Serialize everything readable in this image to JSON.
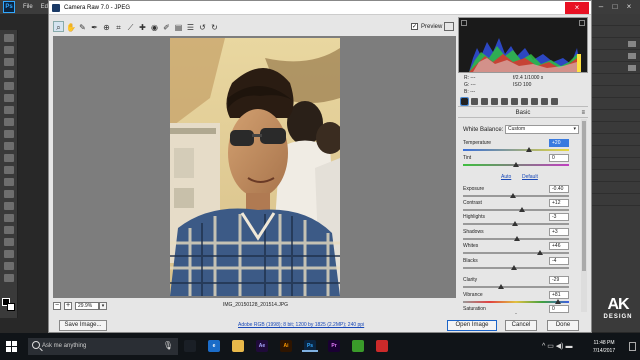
{
  "ps": {
    "logo": "Ps",
    "menu": [
      "File",
      "Edit"
    ],
    "window_controls": [
      "–",
      "□",
      "×"
    ]
  },
  "dialog": {
    "title": "Camera Raw 7.0  -  JPEG",
    "close_glyph": "×",
    "preview_label": "Preview",
    "preview_checked": "✓",
    "zoom_value": "29.9%",
    "filename": "IMG_20150128_201514.JPG",
    "buttons": {
      "save_image": "Save Image...",
      "open_image": "Open Image",
      "cancel": "Cancel",
      "done": "Done"
    },
    "workflow_link": "Adobe RGB (1998); 8 bit; 1200 by 1825 (2.2MP); 240 ppi"
  },
  "tools": [
    "zoom-icon",
    "hand-icon",
    "white-balance-icon",
    "color-sampler-icon",
    "targeted-adjustment-icon",
    "crop-icon",
    "straighten-icon",
    "spot-removal-icon",
    "red-eye-icon",
    "adjustment-brush-icon",
    "graduated-filter-icon",
    "preferences-icon",
    "rotate-ccw-icon",
    "rotate-cw-icon"
  ],
  "readout": {
    "r": "R:  ---",
    "g": "G:  ---",
    "b": "B:  ---",
    "exif1": "f/2.4   1/1000 s",
    "exif2": "ISO 100"
  },
  "panel": {
    "header": "Basic",
    "white_balance_label": "White Balance:",
    "white_balance_value": "Custom",
    "auto": "Auto",
    "default": "Default",
    "sliders": [
      {
        "label": "Temperature",
        "value": "+20",
        "pos": 0.62
      },
      {
        "label": "Tint",
        "value": "0",
        "pos": 0.5
      },
      {
        "label": "Exposure",
        "value": "-0.40",
        "pos": 0.47
      },
      {
        "label": "Contrast",
        "value": "+12",
        "pos": 0.56
      },
      {
        "label": "Highlights",
        "value": "-3",
        "pos": 0.49
      },
      {
        "label": "Shadows",
        "value": "+3",
        "pos": 0.51
      },
      {
        "label": "Whites",
        "value": "+46",
        "pos": 0.73
      },
      {
        "label": "Blacks",
        "value": "-4",
        "pos": 0.48
      },
      {
        "label": "Clarity",
        "value": "-29",
        "pos": 0.36
      },
      {
        "label": "Vibrance",
        "value": "+81",
        "pos": 0.9
      },
      {
        "label": "Saturation",
        "value": "0",
        "pos": 0.5
      }
    ]
  },
  "watermark": {
    "big": "AK",
    "small": "DESIGN"
  },
  "taskbar": {
    "search_placeholder": "Ask me anything",
    "apps": [
      {
        "name": "task-view-icon",
        "label": "",
        "bg": "#1a1f26",
        "fg": "#fff"
      },
      {
        "name": "edge-icon",
        "label": "e",
        "bg": "#1b6cc8",
        "fg": "#fff"
      },
      {
        "name": "file-explorer-icon",
        "label": "",
        "bg": "#e8b84a",
        "fg": "#000"
      },
      {
        "name": "after-effects-icon",
        "label": "Ae",
        "bg": "#1f0a3a",
        "fg": "#a8a8ff"
      },
      {
        "name": "illustrator-icon",
        "label": "Ai",
        "bg": "#2e1500",
        "fg": "#ff9a00"
      },
      {
        "name": "photoshop-icon",
        "label": "Ps",
        "bg": "#0a2440",
        "fg": "#31a8ff"
      },
      {
        "name": "premiere-icon",
        "label": "Pr",
        "bg": "#1a0033",
        "fg": "#e77cff"
      },
      {
        "name": "camtasia-icon",
        "label": "",
        "bg": "#3a9a2a",
        "fg": "#fff"
      },
      {
        "name": "recorder-icon",
        "label": "",
        "bg": "#cc2a2a",
        "fg": "#fff"
      }
    ],
    "tray": "^  ▭  ◀)  ▬",
    "time": "11:48 PM",
    "date": "7/14/2017"
  },
  "colors": {
    "ps_bg": "#282828",
    "dialog_bg": "#e6e6e6",
    "preview_gray": "#7d7d7d",
    "selected_value": "#3a7be0",
    "link": "#1848b8",
    "close_red": "#e81123"
  }
}
